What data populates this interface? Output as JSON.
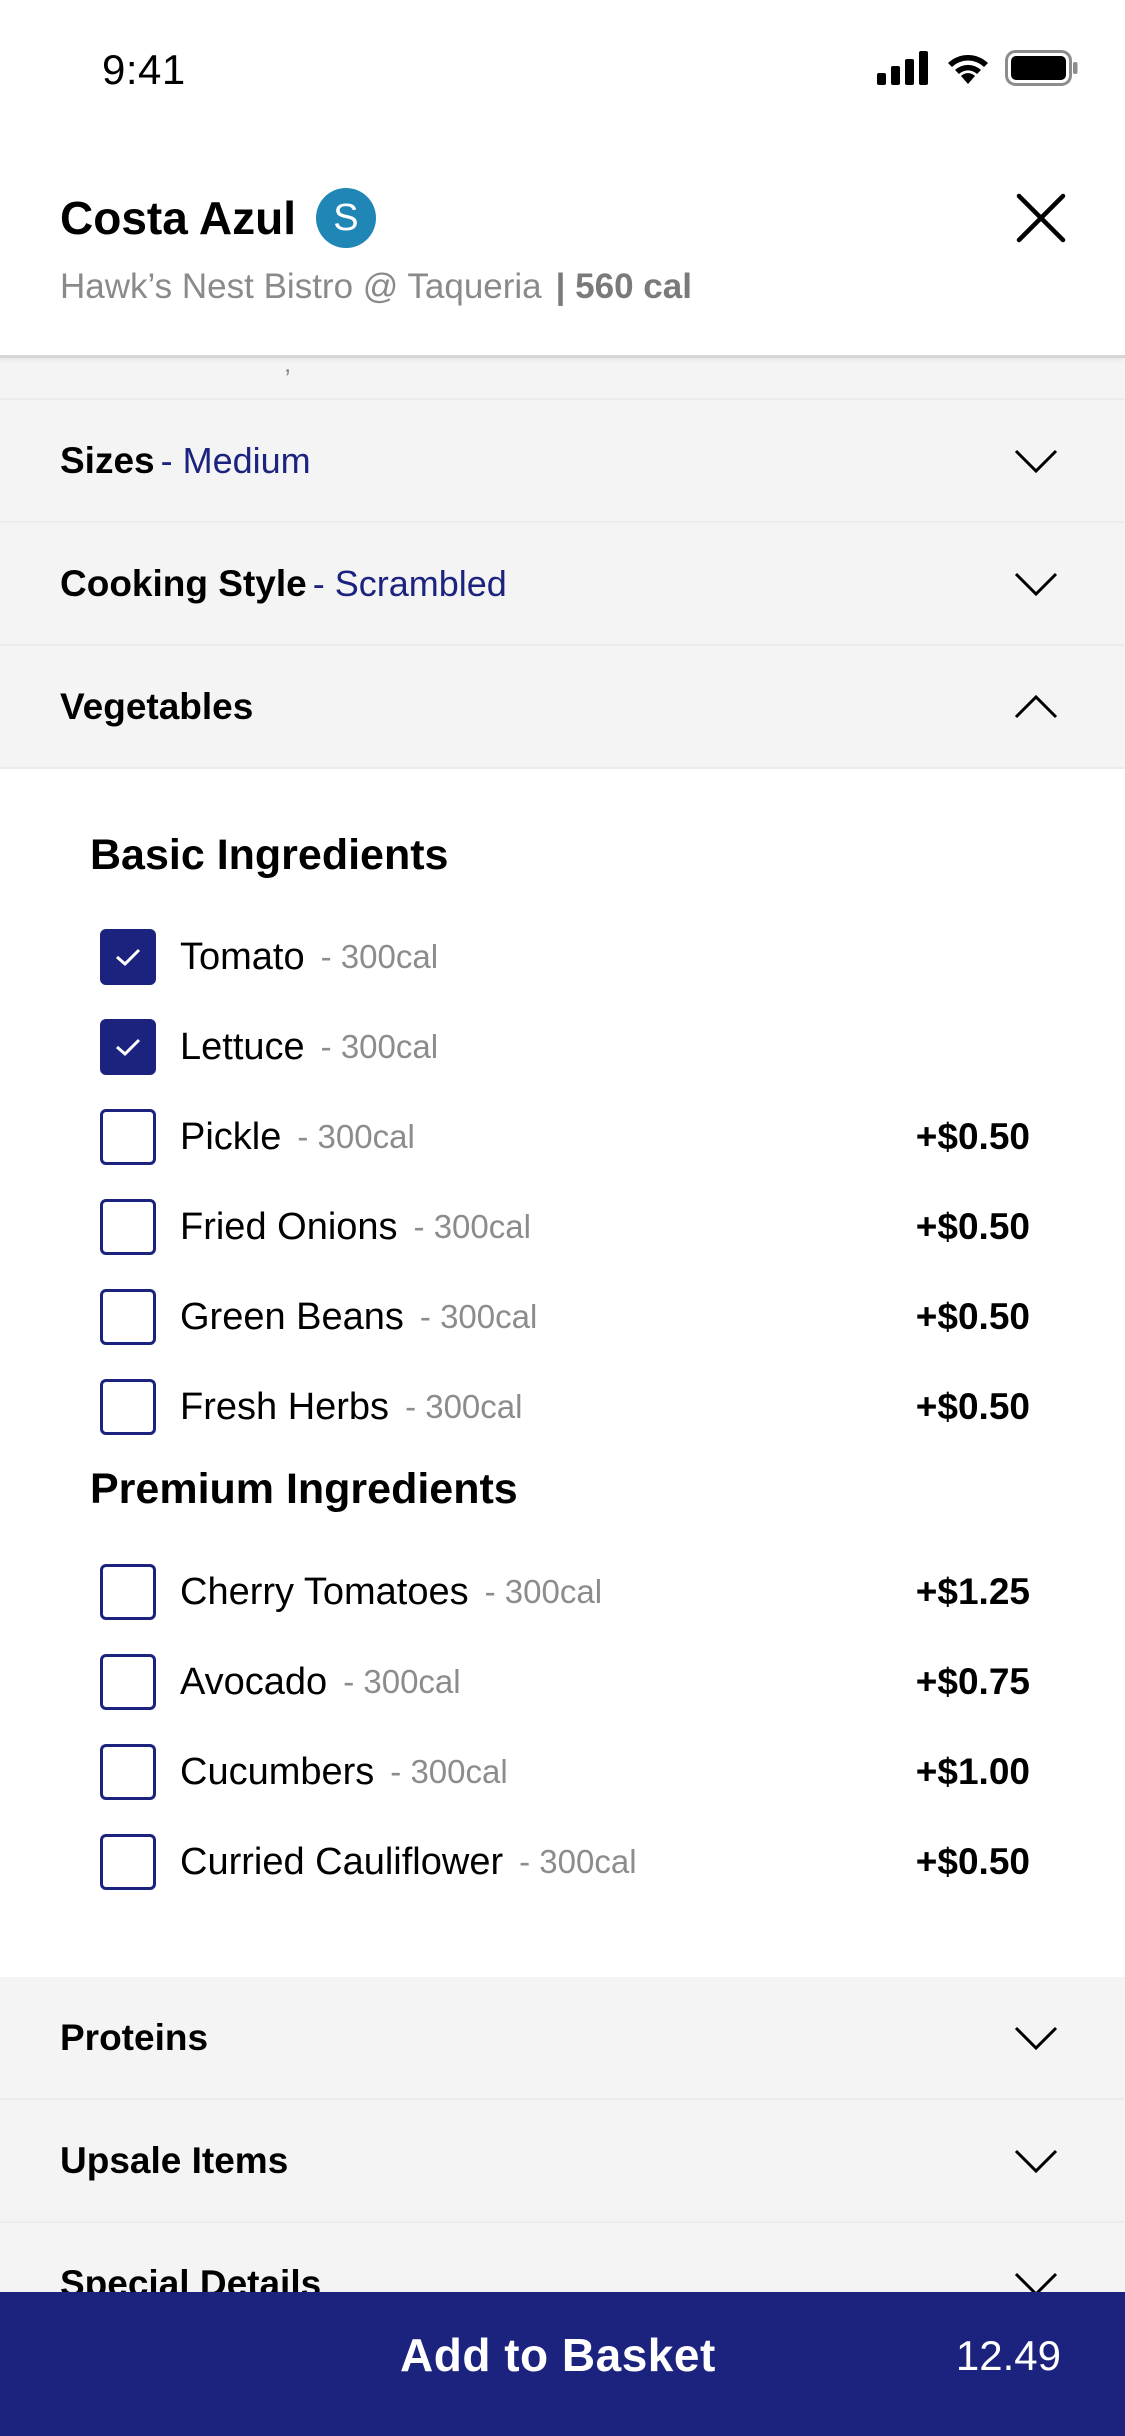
{
  "status": {
    "time": "9:41"
  },
  "header": {
    "title": "Costa Azul",
    "avatar_letter": "S",
    "restaurant": "Hawk’s Nest Bistro @ Taqueria",
    "calories": "| 560 cal"
  },
  "sections": {
    "sizes": {
      "label": "Sizes",
      "value": "- Medium"
    },
    "cooking": {
      "label": "Cooking Style",
      "value": "- Scrambled"
    },
    "vegetables": {
      "label": "Vegetables"
    },
    "proteins": {
      "label": "Proteins"
    },
    "upsale": {
      "label": "Upsale Items"
    },
    "special": {
      "label": "Special Details"
    }
  },
  "basic": {
    "title": "Basic Ingredients",
    "items": [
      {
        "name": "Tomato",
        "cal": "- 300cal",
        "price": "",
        "checked": true
      },
      {
        "name": "Lettuce",
        "cal": "- 300cal",
        "price": "",
        "checked": true
      },
      {
        "name": "Pickle",
        "cal": "- 300cal",
        "price": "+$0.50",
        "checked": false
      },
      {
        "name": "Fried Onions",
        "cal": "- 300cal",
        "price": "+$0.50",
        "checked": false
      },
      {
        "name": "Green Beans",
        "cal": "- 300cal",
        "price": "+$0.50",
        "checked": false
      },
      {
        "name": "Fresh Herbs",
        "cal": "- 300cal",
        "price": "+$0.50",
        "checked": false
      }
    ]
  },
  "premium": {
    "title": "Premium Ingredients",
    "items": [
      {
        "name": "Cherry Tomatoes",
        "cal": "- 300cal",
        "price": "+$1.25",
        "checked": false
      },
      {
        "name": "Avocado",
        "cal": "- 300cal",
        "price": "+$0.75",
        "checked": false
      },
      {
        "name": "Cucumbers",
        "cal": "- 300cal",
        "price": "+$1.00",
        "checked": false
      },
      {
        "name": "Curried Cauliflower",
        "cal": "- 300cal",
        "price": "+$0.50",
        "checked": false
      }
    ]
  },
  "footer": {
    "button_label": "Add to Basket",
    "total": "12.49"
  },
  "colors": {
    "accent": "#1b237f",
    "avatar": "#1f86b5",
    "section_bg": "#f4f4f4"
  }
}
